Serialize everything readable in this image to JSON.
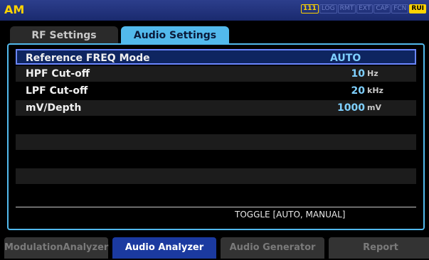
{
  "title": "AM",
  "status_badges": [
    "111",
    "LOG",
    "RMT",
    "EXT",
    "CAP",
    "FCN",
    "RUI"
  ],
  "tabs": [
    {
      "label": "RF Settings",
      "active": false
    },
    {
      "label": "Audio Settings",
      "active": true
    }
  ],
  "settings": [
    {
      "name": "Reference FREQ Mode",
      "value": "AUTO",
      "unit": "",
      "selected": true
    },
    {
      "name": "HPF Cut-off",
      "value": "10",
      "unit": "Hz",
      "selected": false
    },
    {
      "name": "LPF Cut-off",
      "value": "20",
      "unit": "kHz",
      "selected": false
    },
    {
      "name": "mV/Depth",
      "value": "1000",
      "unit": "mV",
      "selected": false
    }
  ],
  "hint": "TOGGLE [AUTO, MANUAL]",
  "softkeys": [
    {
      "label": "ModulationAnalyzer",
      "active": false
    },
    {
      "label": "Audio Analyzer",
      "active": true
    },
    {
      "label": "Audio Generator",
      "active": false
    },
    {
      "label": "Report",
      "active": false
    }
  ],
  "colors": {
    "accent": "#52b9ec",
    "title": "#ffd400",
    "selected_softkey": "#1b3aa0"
  }
}
